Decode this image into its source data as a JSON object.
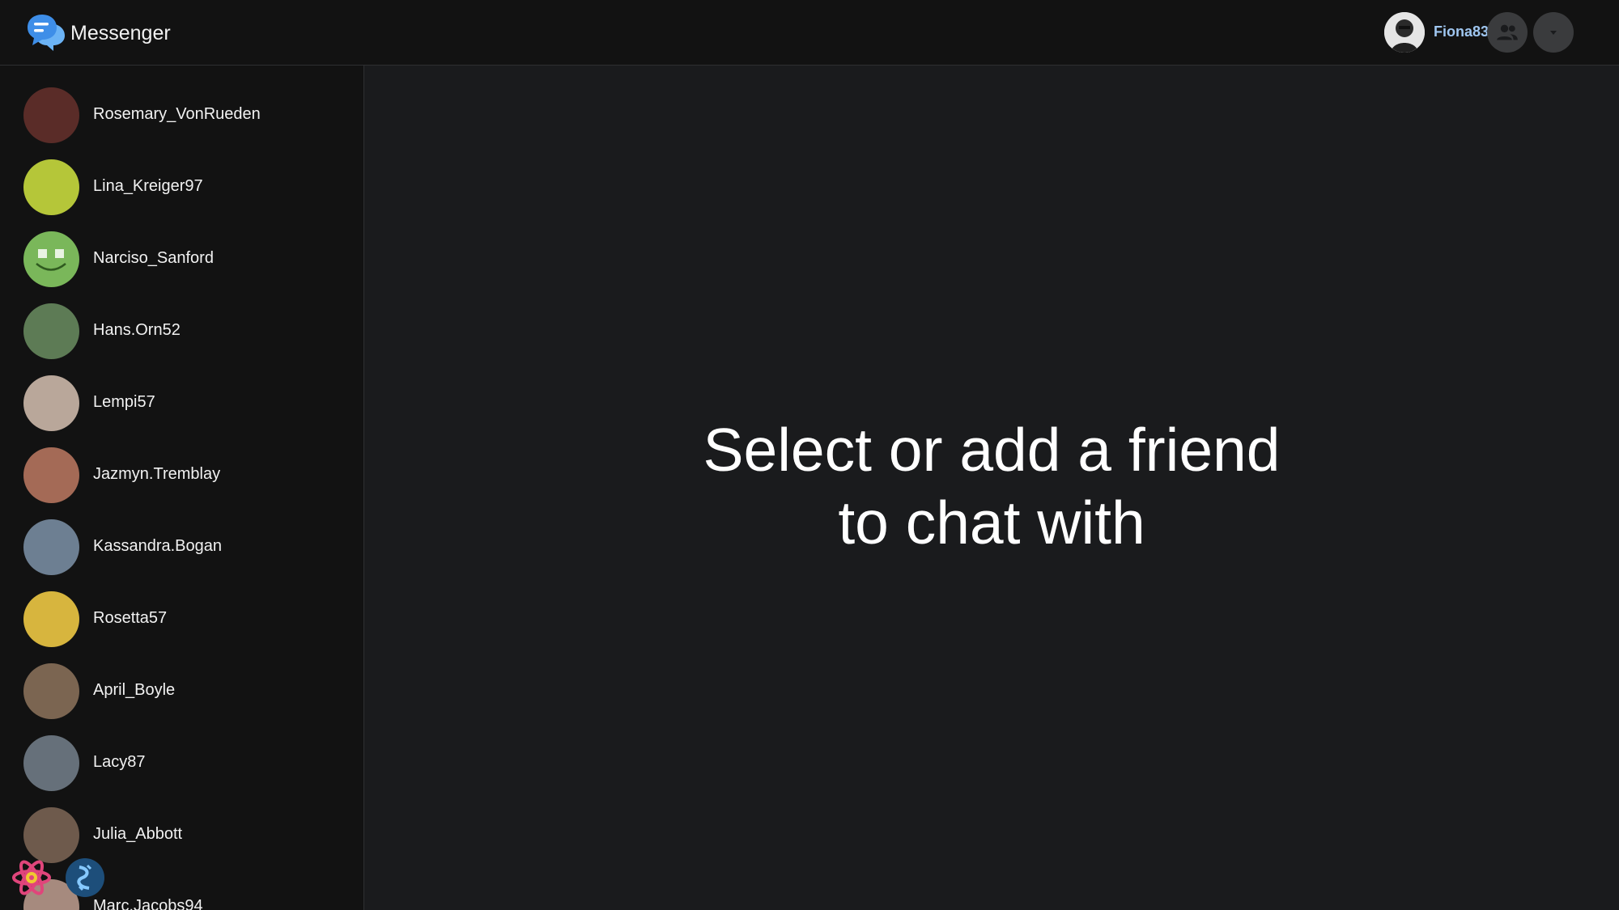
{
  "app": {
    "title": "Messenger"
  },
  "header": {
    "brand": "Messenger",
    "current_user": {
      "name": "Fiona83"
    },
    "friends_button_icon": "people-icon",
    "menu_button_icon": "caret-down-icon"
  },
  "contacts": [
    {
      "name": "Rosemary_VonRueden",
      "color": "#5a2c28"
    },
    {
      "name": "Lina_Kreiger97",
      "color": "#b5c639"
    },
    {
      "name": "Narciso_Sanford",
      "color": "#7ab75a"
    },
    {
      "name": "Hans.Orn52",
      "color": "#5d7b55"
    },
    {
      "name": "Lempi57",
      "color": "#b9a79a"
    },
    {
      "name": "Jazmyn.Tremblay",
      "color": "#a46a56"
    },
    {
      "name": "Kassandra.Bogan",
      "color": "#6d7f92"
    },
    {
      "name": "Rosetta57",
      "color": "#d7b53e"
    },
    {
      "name": "April_Boyle",
      "color": "#7b6551"
    },
    {
      "name": "Lacy87",
      "color": "#66707a"
    },
    {
      "name": "Julia_Abbott",
      "color": "#6e5a4c"
    },
    {
      "name": "Marc.Jacobs94",
      "color": "#a68a7e"
    }
  ],
  "main": {
    "empty_line1": "Select or add a friend",
    "empty_line2": "to chat with"
  },
  "colors": {
    "accent": "#3e8ee8",
    "username": "#9fc6f0",
    "background": "#1a1b1d",
    "panel": "#121212"
  }
}
